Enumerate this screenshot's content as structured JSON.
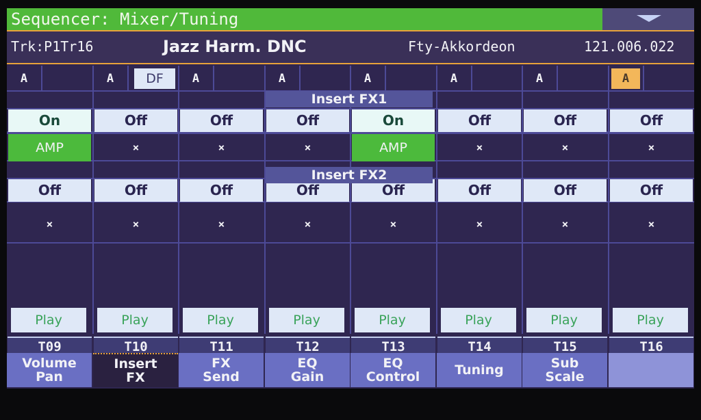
{
  "header": {
    "title": "Sequencer: Mixer/Tuning",
    "menu_icon": "triangle-down-icon"
  },
  "info": {
    "track": "Trk:P1Tr16",
    "song_name": "Jazz Harm. DNC",
    "sound_name": "Fty-Akkordeon",
    "position": "121.006.022"
  },
  "sections": {
    "fx1": "Insert FX1",
    "fx2": "Insert FX2"
  },
  "tracks": [
    {
      "label": "T09",
      "ab": "A",
      "ab_selected": false,
      "df": "",
      "fx1_state": "On",
      "fx1_type": "AMP",
      "fx2_state": "Off",
      "fx2_type": "×",
      "play": "Play"
    },
    {
      "label": "T10",
      "ab": "A",
      "ab_selected": false,
      "df": "DF",
      "fx1_state": "Off",
      "fx1_type": "×",
      "fx2_state": "Off",
      "fx2_type": "×",
      "play": "Play"
    },
    {
      "label": "T11",
      "ab": "A",
      "ab_selected": false,
      "df": "",
      "fx1_state": "Off",
      "fx1_type": "×",
      "fx2_state": "Off",
      "fx2_type": "×",
      "play": "Play"
    },
    {
      "label": "T12",
      "ab": "A",
      "ab_selected": false,
      "df": "",
      "fx1_state": "Off",
      "fx1_type": "×",
      "fx2_state": "Off",
      "fx2_type": "×",
      "play": "Play"
    },
    {
      "label": "T13",
      "ab": "A",
      "ab_selected": false,
      "df": "",
      "fx1_state": "On",
      "fx1_type": "AMP",
      "fx2_state": "Off",
      "fx2_type": "×",
      "play": "Play"
    },
    {
      "label": "T14",
      "ab": "A",
      "ab_selected": false,
      "df": "",
      "fx1_state": "Off",
      "fx1_type": "×",
      "fx2_state": "Off",
      "fx2_type": "×",
      "play": "Play"
    },
    {
      "label": "T15",
      "ab": "A",
      "ab_selected": false,
      "df": "",
      "fx1_state": "Off",
      "fx1_type": "×",
      "fx2_state": "Off",
      "fx2_type": "×",
      "play": "Play"
    },
    {
      "label": "T16",
      "ab": "A",
      "ab_selected": true,
      "df": "",
      "fx1_state": "Off",
      "fx1_type": "×",
      "fx2_state": "Off",
      "fx2_type": "×",
      "play": "Play"
    }
  ],
  "tabs": [
    {
      "line1": "Volume",
      "line2": "Pan",
      "active": false
    },
    {
      "line1": "Insert",
      "line2": "FX",
      "active": true
    },
    {
      "line1": "FX",
      "line2": "Send",
      "active": false
    },
    {
      "line1": "EQ",
      "line2": "Gain",
      "active": false
    },
    {
      "line1": "EQ",
      "line2": "Control",
      "active": false
    },
    {
      "line1": "Tuning",
      "line2": "",
      "active": false
    },
    {
      "line1": "Sub",
      "line2": "Scale",
      "active": false
    },
    {
      "line1": "",
      "line2": "",
      "active": false
    }
  ],
  "colors": {
    "title_bar": "#50b93a",
    "background": "#2f2650",
    "accent_orange": "#e8a23a",
    "fx_on": "#4cba3c",
    "selected_a": "#f3b75a"
  }
}
